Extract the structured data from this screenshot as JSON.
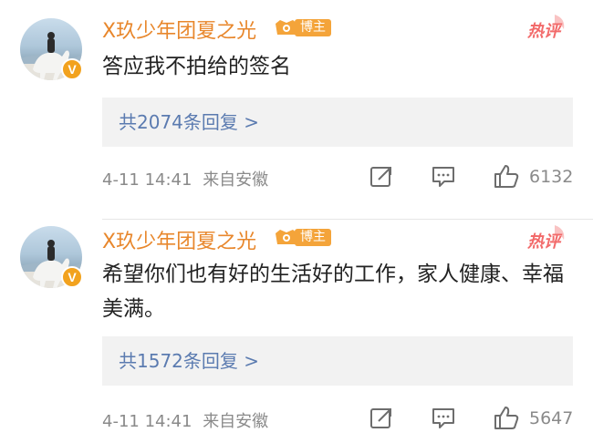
{
  "comments": [
    {
      "username": "X玖少年团夏之光",
      "badge_label": "博主",
      "hot_label": "热评",
      "verified_mark": "V",
      "text": "答应我不拍给的签名",
      "reply_count_label": "共2074条回复 >",
      "timestamp": "4-11 14:41",
      "location": "来自安徽",
      "like_count": "6132"
    },
    {
      "username": "X玖少年团夏之光",
      "badge_label": "博主",
      "hot_label": "热评",
      "verified_mark": "V",
      "text": "希望你们也有好的生活好的工作，家人健康、幸福美满。",
      "reply_count_label": "共1572条回复 >",
      "timestamp": "4-11 14:41",
      "location": "来自安徽",
      "like_count": "5647"
    }
  ],
  "icons": {
    "share": "share-icon",
    "comment": "comment-icon",
    "like": "thumbs-up-icon"
  },
  "colors": {
    "username": "#e8872c",
    "hot_label": "#f26a6a",
    "reply_link": "#5b7bb0",
    "meta": "#8a8a8a",
    "badge": "#f4a43a"
  }
}
